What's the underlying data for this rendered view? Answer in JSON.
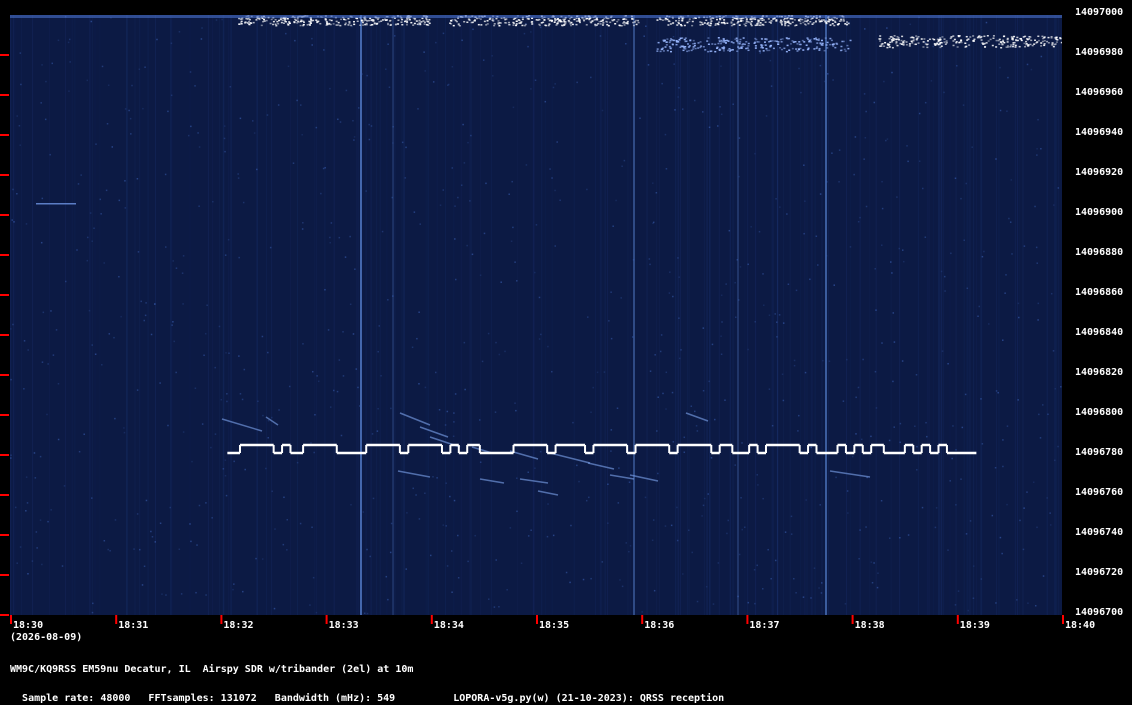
{
  "chart_data": {
    "type": "heatmap",
    "date_label": "(2026-08-09)",
    "x_ticks": [
      "18:30",
      "18:31",
      "18:32",
      "18:33",
      "18:34",
      "18:35",
      "18:36",
      "18:37",
      "18:38",
      "18:39",
      "18:40"
    ],
    "y_ticks": [
      "14097000",
      "14096980",
      "14096960",
      "14096940",
      "14096920",
      "14096900",
      "14096880",
      "14096860",
      "14096840",
      "14096820",
      "14096800",
      "14096780",
      "14096760",
      "14096740",
      "14096720",
      "14096700"
    ],
    "ylim": [
      14096700,
      14097000
    ],
    "xlim": [
      "18:30",
      "18:40"
    ],
    "qrss_trace": {
      "color": "#ffffff",
      "start_time": "18:32",
      "end_time": "18:39.8",
      "low_freq": 14096781,
      "high_freq": 14096785,
      "segments": [
        [
          18.0,
          19.2,
          0
        ],
        [
          19.2,
          22.4,
          1
        ],
        [
          22.4,
          23.2,
          0
        ],
        [
          23.2,
          24.0,
          1
        ],
        [
          24.0,
          25.2,
          0
        ],
        [
          25.2,
          28.4,
          1
        ],
        [
          28.4,
          31.2,
          0
        ],
        [
          31.2,
          34.4,
          1
        ],
        [
          34.4,
          35.2,
          0
        ],
        [
          35.2,
          38.4,
          1
        ],
        [
          38.4,
          39.2,
          0
        ],
        [
          39.2,
          40.0,
          1
        ],
        [
          40.0,
          40.8,
          0
        ],
        [
          40.8,
          42.0,
          1
        ],
        [
          42.0,
          45.2,
          0
        ],
        [
          45.2,
          48.4,
          1
        ],
        [
          48.4,
          49.2,
          0
        ],
        [
          49.2,
          52.0,
          1
        ],
        [
          52.0,
          52.8,
          0
        ],
        [
          52.8,
          56.0,
          1
        ],
        [
          56.0,
          56.8,
          0
        ],
        [
          56.8,
          60.0,
          1
        ],
        [
          60.0,
          60.8,
          0
        ],
        [
          60.8,
          64.0,
          1
        ],
        [
          64.0,
          64.8,
          0
        ],
        [
          64.8,
          66.0,
          1
        ],
        [
          66.0,
          67.6,
          0
        ],
        [
          67.6,
          68.4,
          1
        ],
        [
          68.4,
          69.2,
          0
        ],
        [
          69.2,
          72.4,
          1
        ],
        [
          72.4,
          73.2,
          0
        ],
        [
          73.2,
          74.0,
          1
        ],
        [
          74.0,
          76.0,
          0
        ],
        [
          76.0,
          76.8,
          1
        ],
        [
          76.8,
          77.6,
          0
        ],
        [
          77.6,
          78.4,
          1
        ],
        [
          78.4,
          79.2,
          0
        ],
        [
          79.2,
          80.4,
          1
        ],
        [
          80.4,
          82.4,
          0
        ],
        [
          82.4,
          83.2,
          1
        ],
        [
          83.2,
          84.0,
          0
        ],
        [
          84.0,
          84.8,
          1
        ],
        [
          84.8,
          85.6,
          0
        ],
        [
          85.6,
          86.4,
          1
        ],
        [
          86.4,
          89.2,
          0
        ]
      ]
    }
  },
  "footer": {
    "station": "WM9C/KQ9RSS EM59nu Decatur, IL  Airspy SDR w/tribander (2el) at 10m",
    "sample_rate": "Sample rate: 48000",
    "fft_samples": "FFTsamples: 131072",
    "bandwidth": "Bandwidth (mHz): 549",
    "software": "LOPORA-v5g.py(w) (21-10-2023): QRSS reception"
  },
  "colors": {
    "background": "#000000",
    "waterfall": "#0c1a44",
    "tick": "#ff0000",
    "text": "#ffffff"
  }
}
